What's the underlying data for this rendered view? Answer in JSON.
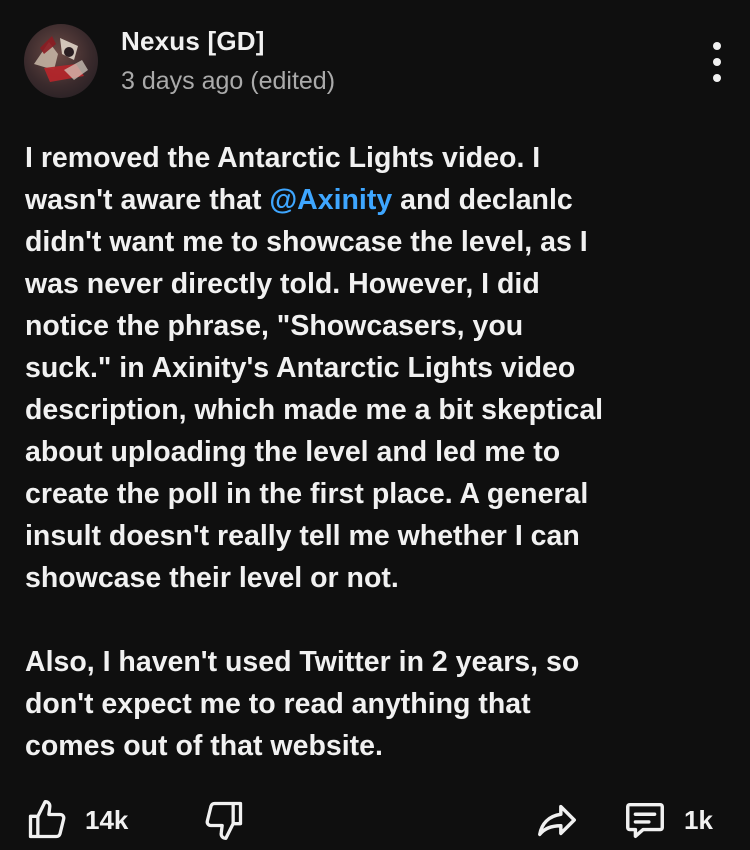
{
  "comment": {
    "author": "Nexus [GD]",
    "meta": "3 days ago (edited)",
    "lines": [
      "I removed the Antarctic Lights video. I",
      "wasn't aware that ",
      "@Axinity",
      " and declanlc",
      "didn't want me to showcase the level, as I",
      "was never directly told. However, I did",
      "notice the phrase, \"Showcasers, you",
      "suck.\" in Axinity's Antarctic Lights video",
      "description, which made me a bit skeptical",
      "about uploading the level and led me to",
      "create the poll in the first place. A general",
      "insult doesn't really tell me whether I can",
      "showcase their level or not.",
      "Also, I haven't used Twitter in 2 years, so",
      "don't expect me to read anything that",
      "comes out of that website."
    ]
  },
  "actions": {
    "like_count": "14k",
    "reply_count": "1k"
  },
  "icons": {
    "like": "thumbs-up-icon",
    "dislike": "thumbs-down-icon",
    "share": "share-icon",
    "reply": "comment-icon",
    "menu": "more-vertical-icon"
  },
  "colors": {
    "background": "#0f0f0f",
    "text": "#f1f1f1",
    "meta": "#aaaaaa",
    "mention": "#3ea6ff"
  }
}
